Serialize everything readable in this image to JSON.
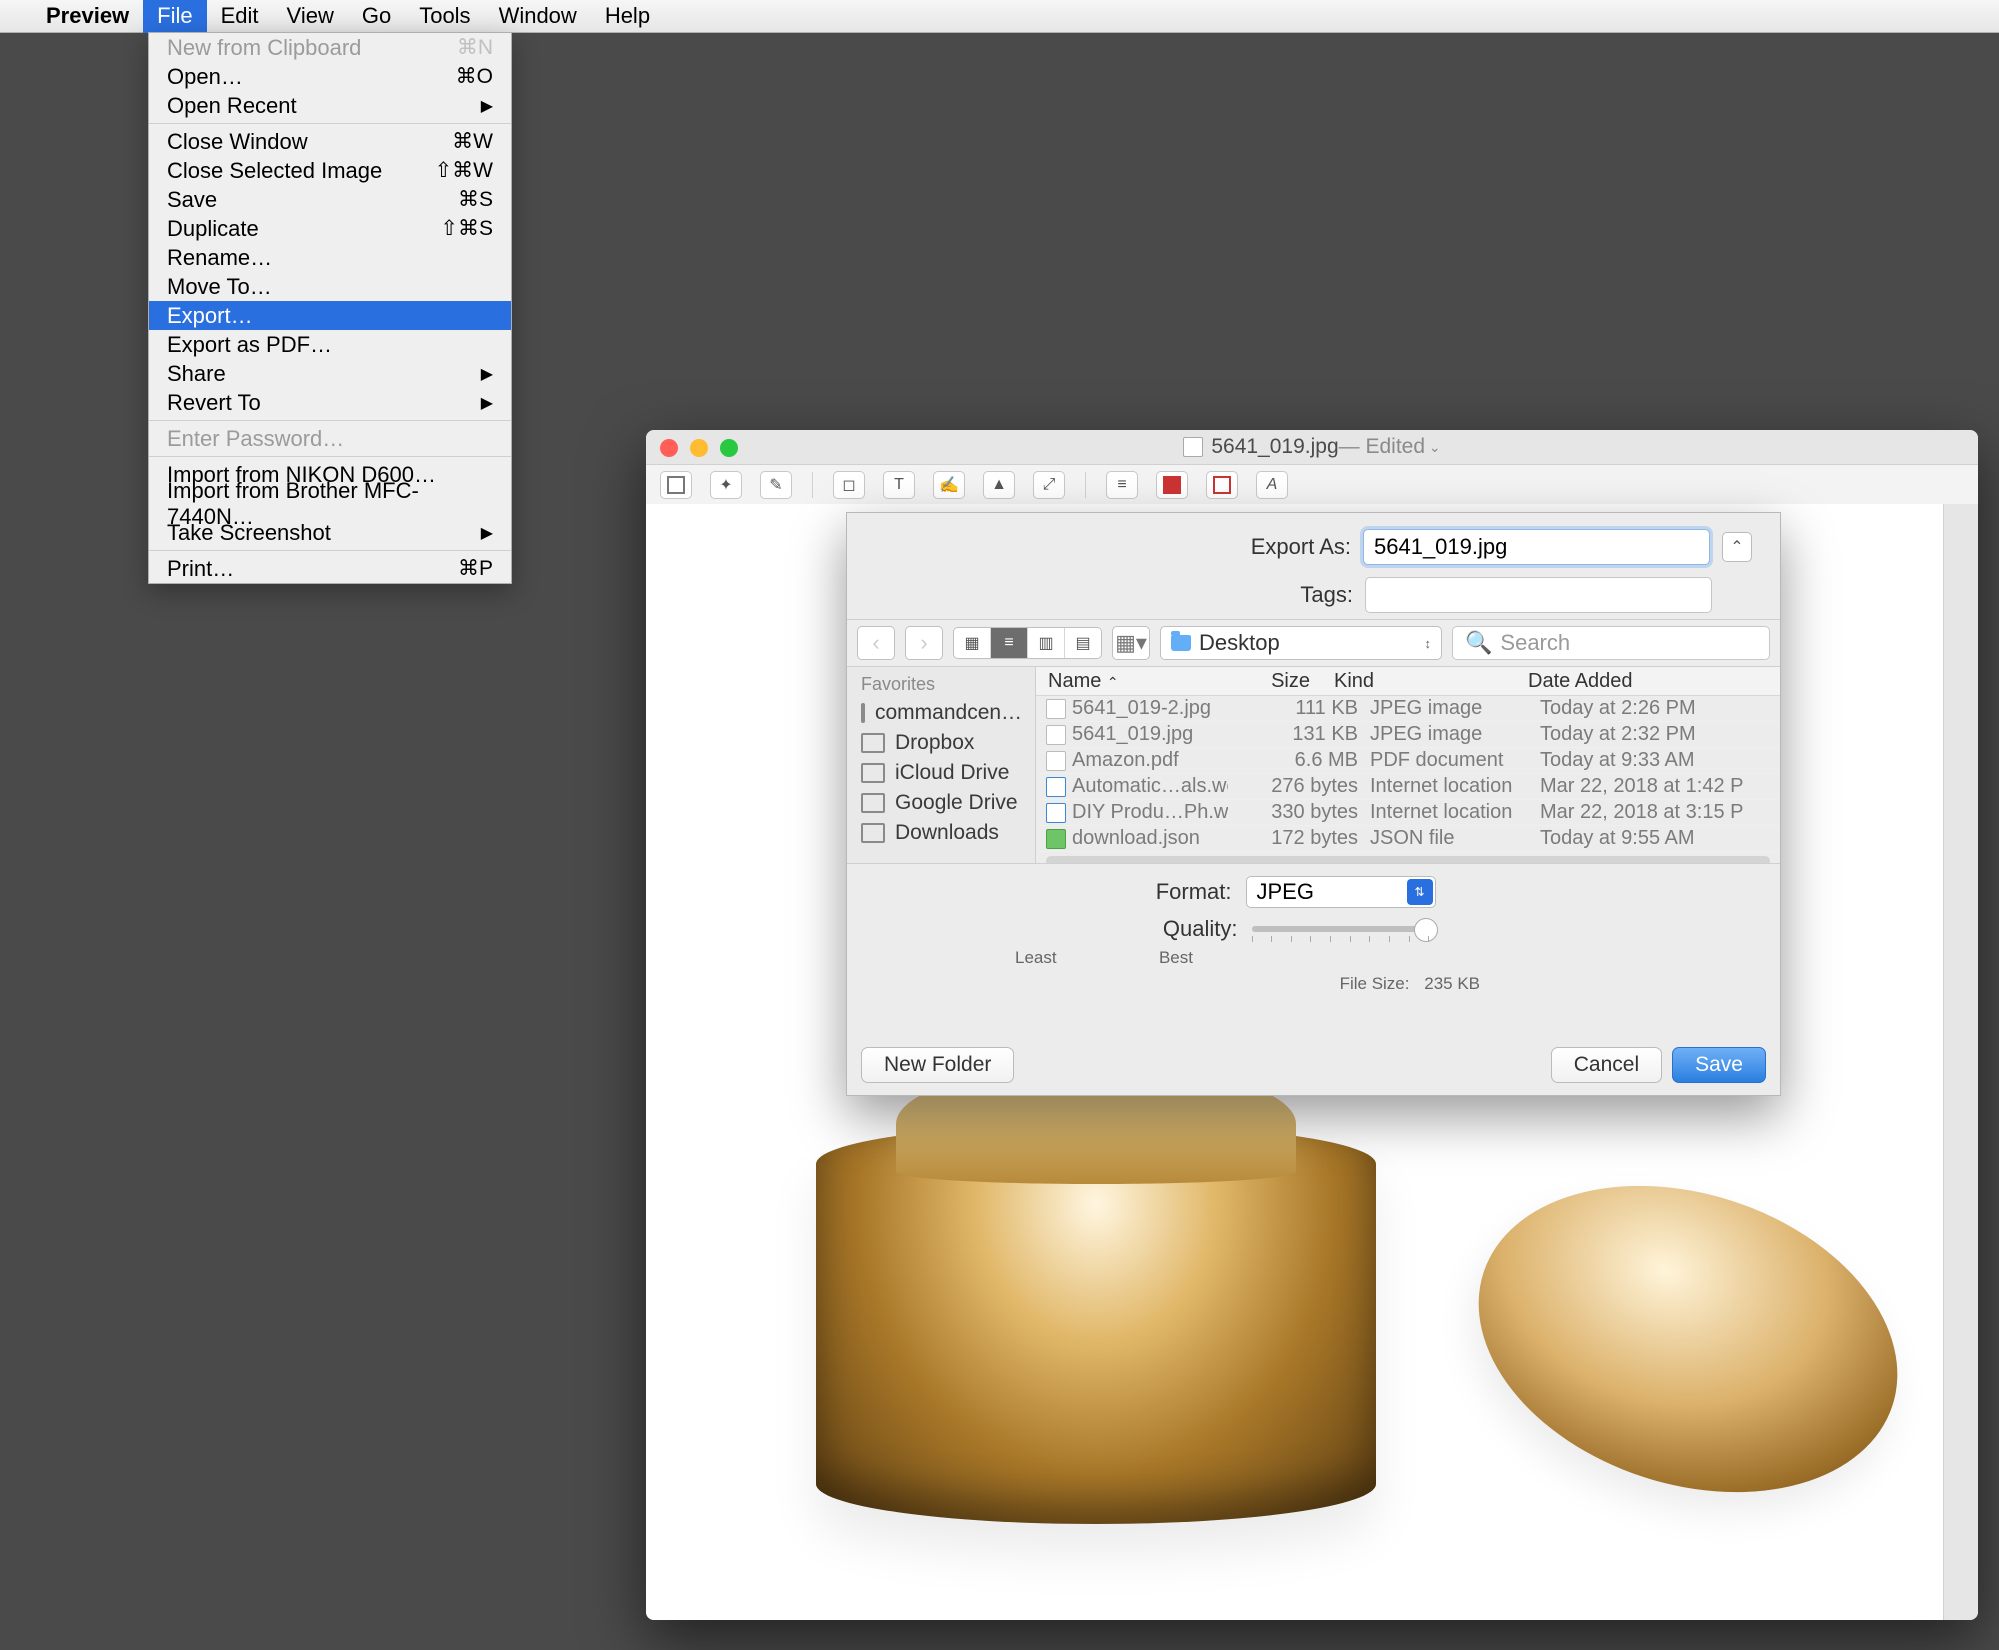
{
  "menubar": {
    "app": "Preview",
    "items": [
      "File",
      "Edit",
      "View",
      "Go",
      "Tools",
      "Window",
      "Help"
    ],
    "active": "File"
  },
  "file_menu": {
    "groups": [
      [
        {
          "label": "New from Clipboard",
          "shortcut": "⌘N",
          "disabled": true
        },
        {
          "label": "Open…",
          "shortcut": "⌘O"
        },
        {
          "label": "Open Recent",
          "submenu": true
        }
      ],
      [
        {
          "label": "Close Window",
          "shortcut": "⌘W"
        },
        {
          "label": "Close Selected Image",
          "shortcut": "⇧⌘W"
        },
        {
          "label": "Save",
          "shortcut": "⌘S"
        },
        {
          "label": "Duplicate",
          "shortcut": "⇧⌘S"
        },
        {
          "label": "Rename…"
        },
        {
          "label": "Move To…"
        },
        {
          "label": "Export…",
          "selected": true
        },
        {
          "label": "Export as PDF…"
        },
        {
          "label": "Share",
          "submenu": true
        },
        {
          "label": "Revert To",
          "submenu": true
        }
      ],
      [
        {
          "label": "Enter Password…",
          "disabled": true
        }
      ],
      [
        {
          "label": "Import from NIKON D600…"
        },
        {
          "label": "Import from Brother MFC-7440N…"
        },
        {
          "label": "Take Screenshot",
          "submenu": true
        }
      ],
      [
        {
          "label": "Print…",
          "shortcut": "⌘P"
        }
      ]
    ]
  },
  "window": {
    "title": "5641_019.jpg",
    "edited_suffix": " — Edited"
  },
  "export": {
    "export_as_label": "Export As:",
    "filename": "5641_019.jpg",
    "tags_label": "Tags:",
    "tags_value": "",
    "location_label": "Desktop",
    "search_placeholder": "Search",
    "sidebar_header": "Favorites",
    "sidebar_items": [
      "commandcen…",
      "Dropbox",
      "iCloud Drive",
      "Google Drive",
      "Downloads"
    ],
    "columns": {
      "name": "Name",
      "size": "Size",
      "kind": "Kind",
      "date": "Date Added"
    },
    "files": [
      {
        "name": "5641_019-2.jpg",
        "size": "111 KB",
        "kind": "JPEG image",
        "date": "Today at 2:26 PM"
      },
      {
        "name": "5641_019.jpg",
        "size": "131 KB",
        "kind": "JPEG image",
        "date": "Today at 2:32 PM"
      },
      {
        "name": "Amazon.pdf",
        "size": "6.6 MB",
        "kind": "PDF document",
        "date": "Today at 9:33 AM"
      },
      {
        "name": "Automatic…als.webloc",
        "size": "276 bytes",
        "kind": "Internet location",
        "date": "Mar 22, 2018 at 1:42 P"
      },
      {
        "name": "DIY Produ…Ph.webloc",
        "size": "330 bytes",
        "kind": "Internet location",
        "date": "Mar 22, 2018 at 3:15 P"
      },
      {
        "name": "download.json",
        "size": "172 bytes",
        "kind": "JSON file",
        "date": "Today at 9:55 AM"
      }
    ],
    "format_label": "Format:",
    "format_value": "JPEG",
    "quality_label": "Quality:",
    "quality_least": "Least",
    "quality_best": "Best",
    "file_size_label": "File Size:",
    "file_size_value": "235 KB",
    "new_folder": "New Folder",
    "cancel": "Cancel",
    "save": "Save"
  }
}
